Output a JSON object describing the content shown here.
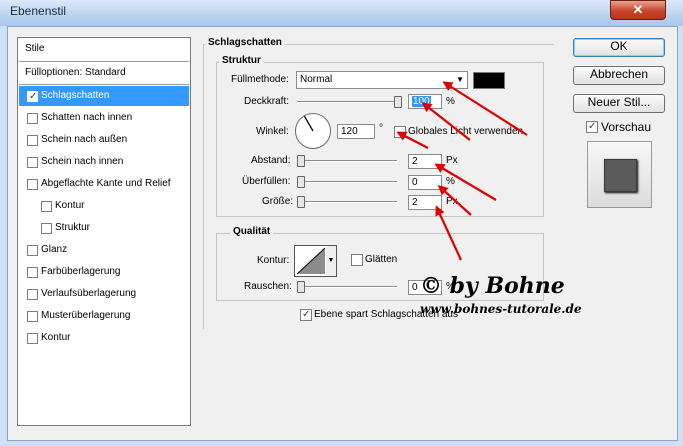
{
  "window": {
    "title": "Ebenenstil",
    "close_glyph": "✕"
  },
  "sidebar": {
    "items": [
      {
        "label": "Stile",
        "checkbox": false
      },
      {
        "label": "Fülloptionen: Standard",
        "checkbox": false
      },
      {
        "label": "Schlagschatten",
        "checkbox": true,
        "checked": true,
        "selected": true
      },
      {
        "label": "Schatten nach innen",
        "checkbox": true,
        "checked": false
      },
      {
        "label": "Schein nach außen",
        "checkbox": true,
        "checked": false
      },
      {
        "label": "Schein nach innen",
        "checkbox": true,
        "checked": false
      },
      {
        "label": "Abgeflachte Kante und Relief",
        "checkbox": true,
        "checked": false
      },
      {
        "label": "Kontur",
        "checkbox": true,
        "checked": false,
        "indent": true
      },
      {
        "label": "Struktur",
        "checkbox": true,
        "checked": false,
        "indent": true
      },
      {
        "label": "Glanz",
        "checkbox": true,
        "checked": false
      },
      {
        "label": "Farbüberlagerung",
        "checkbox": true,
        "checked": false
      },
      {
        "label": "Verlaufsüberlagerung",
        "checkbox": true,
        "checked": false
      },
      {
        "label": "Musterüberlagerung",
        "checkbox": true,
        "checked": false
      },
      {
        "label": "Kontur",
        "checkbox": true,
        "checked": false
      }
    ]
  },
  "main": {
    "section_title": "Schlagschatten",
    "struktur": {
      "title": "Struktur",
      "blend_label": "Füllmethode:",
      "blend_value": "Normal",
      "shadow_color": "#000000",
      "opacity_label": "Deckkraft:",
      "opacity_value": "100",
      "opacity_unit": "%",
      "opacity_level": 1.0,
      "angle_label": "Winkel:",
      "angle_value": "120",
      "angle_unit": "°",
      "global_light_label": "Globales Licht verwenden",
      "global_light_checked": false,
      "distance_label": "Abstand:",
      "distance_value": "2",
      "distance_unit": "Px",
      "spread_label": "Überfüllen:",
      "spread_value": "0",
      "spread_unit": "%",
      "size_label": "Größe:",
      "size_value": "2",
      "size_unit": "Px"
    },
    "qualitaet": {
      "title": "Qualität",
      "contour_label": "Kontur:",
      "antialias_label": "Glätten",
      "antialias_checked": false,
      "noise_label": "Rauschen:",
      "noise_value": "0",
      "noise_unit": "%"
    },
    "knockout_label": "Ebene spart Schlagschatten aus",
    "knockout_checked": true
  },
  "actions": {
    "ok_label": "OK",
    "cancel_label": "Abbrechen",
    "new_style_label": "Neuer Stil...",
    "preview_label": "Vorschau",
    "preview_checked": true
  },
  "watermark": {
    "line1": "© by Bohne",
    "line2": "www.bohnes-tutorale.de"
  },
  "colors": {
    "selection": "#3399ff",
    "arrow": "#e00000",
    "title_bar": "#bcd3f0"
  }
}
